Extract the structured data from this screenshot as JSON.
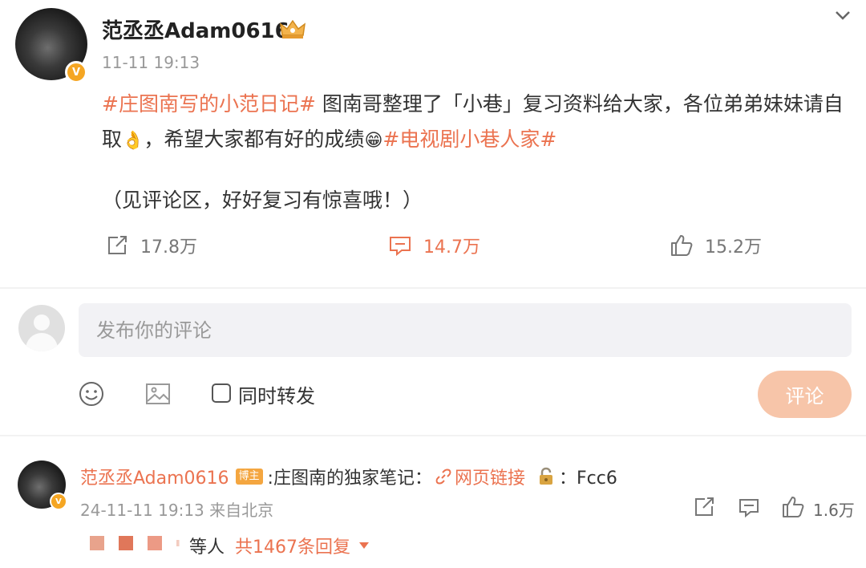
{
  "post": {
    "author": "范丞丞Adam0616",
    "time": "11-11 19:13",
    "verified_badge": "V",
    "body": {
      "tag1": "#庄图南写的小范日记#",
      "text1": " 图南哥整理了「小巷」复习资料给大家，各位弟弟妹妹请自取",
      "emoji_ok": "👌",
      "text2": "，希望大家都有好的成绩",
      "emoji_smile": "😁",
      "tag2": "#电视剧小巷人家#"
    },
    "note": "（见评论区，好好复习有惊喜哦！）",
    "actions": {
      "repost_count": "17.8万",
      "comment_count": "14.7万",
      "like_count": "15.2万"
    }
  },
  "composer": {
    "placeholder": "发布你的评论",
    "repost_label": "同时转发",
    "submit_label": "评论"
  },
  "comment": {
    "author": "范丞丞Adam0616",
    "badge": "博主",
    "text": ":庄图南的独家笔记：",
    "link_text": "网页链接",
    "code_text": "：Fcc6",
    "meta": "24-11-11 19:13 来自北京",
    "like_count": "1.6万",
    "replies": {
      "suffix": "等人",
      "count": "共1467条回复"
    }
  },
  "colors": {
    "accent": "#eb7350",
    "badge": "#f5a623",
    "submit_disabled": "#f7c5a9",
    "input_bg": "#f2f2f5"
  },
  "icons": [
    "chevron-down-icon",
    "crown-icon",
    "repost-icon",
    "comment-icon",
    "like-icon",
    "emoji-icon",
    "image-icon",
    "link-icon",
    "lock-icon",
    "caret-down-icon"
  ]
}
